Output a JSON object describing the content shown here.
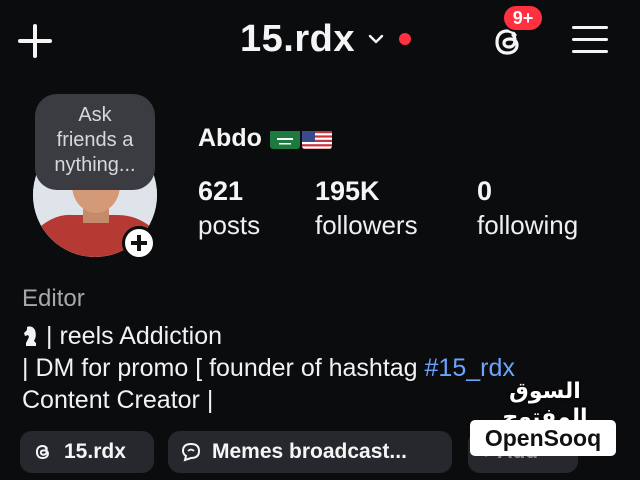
{
  "header": {
    "username": "15.rdx",
    "notification_badge": "9+",
    "accent_color": "#ff3040"
  },
  "avatar": {
    "note": "Ask\nfriends a\nnything..."
  },
  "profile": {
    "display_name": "Abdo",
    "flags": [
      "saudi-arabia-flag",
      "usa-flag"
    ],
    "stats": [
      {
        "value": "621",
        "label": "posts"
      },
      {
        "value": "195K",
        "label": "followers"
      },
      {
        "value": "0",
        "label": "following"
      }
    ]
  },
  "bio": {
    "category": "Editor",
    "line1": "| reels Addiction",
    "line2_prefix": "| DM for promo [ founder of hashtag ",
    "line2_hashtag": "#15_rdx",
    "line3": "Content Creator |",
    "hashtag_color": "#6ba4ff"
  },
  "chips": {
    "threads_label": "15.rdx",
    "broadcast_label": "Memes broadcast...",
    "add_label": "+ Add"
  },
  "watermark": {
    "arabic": "السوق المفتوح",
    "logo": "OpenSooq"
  }
}
